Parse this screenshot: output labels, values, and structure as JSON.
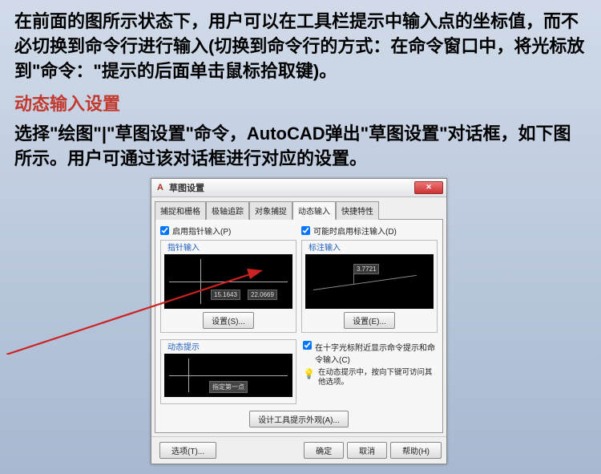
{
  "intro_para": "在前面的图所示状态下，用户可以在工具栏提示中输入点的坐标值，而不必切换到命令行进行输入(切换到命令行的方式：在命令窗口中，将光标放到\"命令：\"提示的后面单击鼠标拾取键)。",
  "heading": "动态输入设置",
  "para2": "选择\"绘图\"|\"草图设置\"命令，AutoCAD弹出\"草图设置\"对话框，如下图所示。用户可通过该对话框进行对应的设置。",
  "dialog": {
    "title": "草图设置",
    "tabs": [
      "捕捉和栅格",
      "极轴追踪",
      "对象捕捉",
      "动态输入",
      "快捷特性"
    ],
    "active_tab": "动态输入",
    "pointer_input": {
      "checkbox": "启用指针输入(P)",
      "legend": "指针输入",
      "coord1": "15.1643",
      "coord2": "22.0669",
      "settings_btn": "设置(S)..."
    },
    "dim_input": {
      "checkbox": "可能时启用标注输入(D)",
      "legend": "标注输入",
      "dim_value": "3.7721",
      "settings_btn": "设置(E)..."
    },
    "dyn_prompt": {
      "legend": "动态提示",
      "prompt_text": "指定第一点",
      "checkbox": "在十字光标附近显示命令提示和命令输入(C)",
      "tip": "在动态提示中，按向下键可访问其他选项。"
    },
    "design_tooltip_btn": "设计工具提示外观(A)...",
    "footer": {
      "options": "选项(T)...",
      "ok": "确定",
      "cancel": "取消",
      "help": "帮助(H)"
    }
  }
}
